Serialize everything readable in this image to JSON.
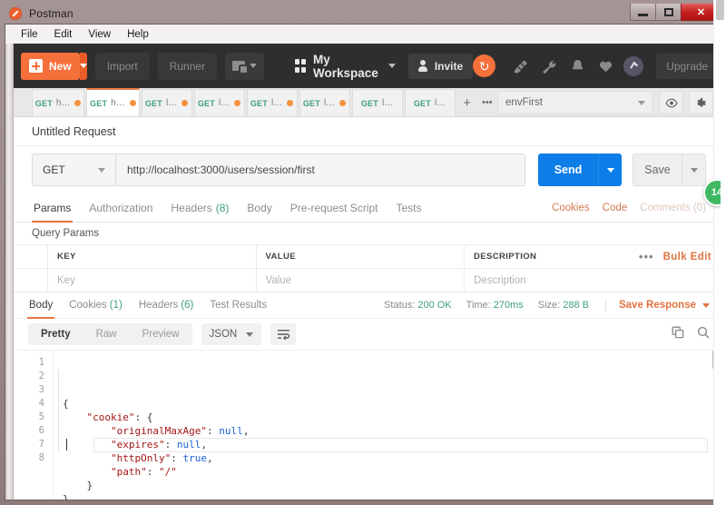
{
  "window": {
    "title": "Postman",
    "logo_icon": "postman-logo-icon",
    "minimize_label": "Minimize",
    "maximize_label": "Maximize",
    "close_label": "✕"
  },
  "menubar": {
    "items": [
      {
        "label": "File"
      },
      {
        "label": "Edit"
      },
      {
        "label": "View"
      },
      {
        "label": "Help"
      }
    ]
  },
  "toolbar": {
    "new_label": "New",
    "import_label": "Import",
    "runner_label": "Runner",
    "new_folder_icon": "new-folder-icon",
    "workspace_label": "My Workspace",
    "workspace_icon": "grid-icon",
    "invite_label": "Invite",
    "sync_icon": "sync-icon",
    "sync_glyph": "↻",
    "icons": [
      {
        "name": "satellite-icon"
      },
      {
        "name": "wrench-icon"
      },
      {
        "name": "bell-icon"
      },
      {
        "name": "heart-icon"
      },
      {
        "name": "account-avatar-icon"
      }
    ],
    "upgrade_label": "Upgrade"
  },
  "tabstrip": {
    "tabs": [
      {
        "method": "GET",
        "title": "h…",
        "dirty": true,
        "active": false
      },
      {
        "method": "GET",
        "title": "h…",
        "dirty": true,
        "active": true
      },
      {
        "method": "GET",
        "title": "l…",
        "dirty": true,
        "active": false
      },
      {
        "method": "GET",
        "title": "l…",
        "dirty": true,
        "active": false
      },
      {
        "method": "GET",
        "title": "l…",
        "dirty": true,
        "active": false
      },
      {
        "method": "GET",
        "title": "l…",
        "dirty": true,
        "active": false
      },
      {
        "method": "GET",
        "title": "l…",
        "dirty": false,
        "active": false
      },
      {
        "method": "GET",
        "title": "l…",
        "dirty": false,
        "active": false
      }
    ],
    "add_label": "+",
    "more_label": "•••",
    "environment": {
      "selected": "envFirst",
      "eye_icon": "eye-icon",
      "gear_icon": "gear-icon"
    }
  },
  "request": {
    "name": "Untitled Request",
    "method": "GET",
    "url": "http://localhost:3000/users/session/first",
    "send_label": "Send",
    "save_label": "Save",
    "tabs": [
      {
        "label": "Params",
        "count": "",
        "active": true
      },
      {
        "label": "Authorization",
        "count": "",
        "active": false
      },
      {
        "label": "Headers",
        "count": "(8)",
        "active": false
      },
      {
        "label": "Body",
        "count": "",
        "active": false
      },
      {
        "label": "Pre-request Script",
        "count": "",
        "active": false
      },
      {
        "label": "Tests",
        "count": "",
        "active": false
      }
    ],
    "links": [
      {
        "label": "Cookies",
        "muted": false
      },
      {
        "label": "Code",
        "muted": false
      },
      {
        "label": "Comments (0)",
        "muted": true
      }
    ]
  },
  "query_params": {
    "section_label": "Query Params",
    "headers": [
      "KEY",
      "VALUE",
      "DESCRIPTION"
    ],
    "rows": [
      {
        "key": "Key",
        "value": "Value",
        "description": "Description"
      }
    ],
    "more_label": "•••",
    "bulk_edit_label": "Bulk Edit"
  },
  "response": {
    "tabs": [
      {
        "label": "Body",
        "count": "",
        "active": true
      },
      {
        "label": "Cookies",
        "count": "(1)",
        "active": false
      },
      {
        "label": "Headers",
        "count": "(6)",
        "active": false
      },
      {
        "label": "Test Results",
        "count": "",
        "active": false
      }
    ],
    "status_label": "Status:",
    "status_value": "200 OK",
    "time_label": "Time:",
    "time_value": "270ms",
    "size_label": "Size:",
    "size_value": "288 B",
    "save_response_label": "Save Response",
    "formats": [
      {
        "label": "Pretty",
        "active": true
      },
      {
        "label": "Raw",
        "active": false
      },
      {
        "label": "Preview",
        "active": false
      }
    ],
    "language": "JSON",
    "wrap_icon": "wrap-lines-icon",
    "copy_icon": "copy-icon",
    "search_icon": "search-icon",
    "line_numbers": [
      "1",
      "2",
      "3",
      "4",
      "5",
      "6",
      "7",
      "8"
    ],
    "body_lines": [
      [
        {
          "t": "{",
          "c": "pn"
        }
      ],
      [
        {
          "t": "    ",
          "c": "pn"
        },
        {
          "t": "\"cookie\"",
          "c": "k"
        },
        {
          "t": ": {",
          "c": "pn"
        }
      ],
      [
        {
          "t": "        ",
          "c": "pn"
        },
        {
          "t": "\"originalMaxAge\"",
          "c": "k"
        },
        {
          "t": ": ",
          "c": "pn"
        },
        {
          "t": "null",
          "c": "lit"
        },
        {
          "t": ",",
          "c": "pn"
        }
      ],
      [
        {
          "t": "        ",
          "c": "pn"
        },
        {
          "t": "\"expires\"",
          "c": "k"
        },
        {
          "t": ": ",
          "c": "pn"
        },
        {
          "t": "null",
          "c": "lit"
        },
        {
          "t": ",",
          "c": "pn"
        }
      ],
      [
        {
          "t": "        ",
          "c": "pn"
        },
        {
          "t": "\"httpOnly\"",
          "c": "k"
        },
        {
          "t": ": ",
          "c": "pn"
        },
        {
          "t": "true",
          "c": "lit"
        },
        {
          "t": ",",
          "c": "pn"
        }
      ],
      [
        {
          "t": "        ",
          "c": "pn"
        },
        {
          "t": "\"path\"",
          "c": "k"
        },
        {
          "t": ": ",
          "c": "pn"
        },
        {
          "t": "\"/\"",
          "c": "str"
        }
      ],
      [
        {
          "t": "    }",
          "c": "pn"
        }
      ],
      [
        {
          "t": "}",
          "c": "pn"
        }
      ]
    ]
  },
  "fab": {
    "label": "14",
    "color": "#3fb862"
  }
}
